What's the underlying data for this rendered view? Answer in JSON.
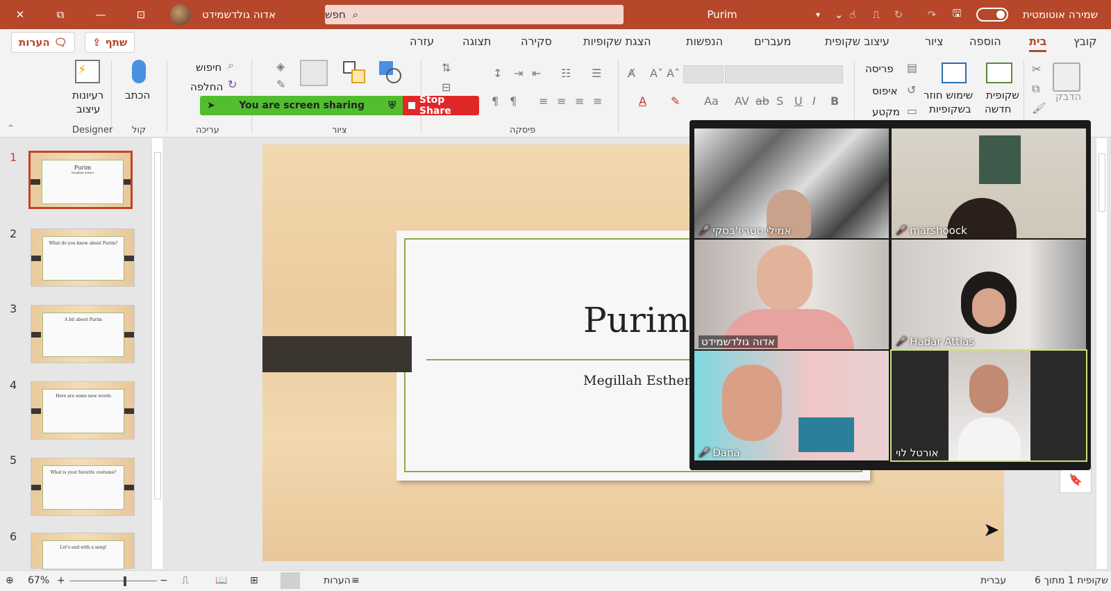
{
  "titlebar": {
    "user_name": "אדוה גולדשמידט",
    "search_placeholder": "חפש",
    "doc_title": "Purim",
    "autosave_label": "שמירה אוטומטית",
    "bg_color": "#b7472a"
  },
  "tabs": [
    "קובץ",
    "בית",
    "הוספה",
    "ציור",
    "עיצוב שקופית",
    "מעברים",
    "הנפשות",
    "הצגת שקופיות",
    "סקירה",
    "תצוגה",
    "עזרה"
  ],
  "active_tab": "בית",
  "comments_btn": "הערות",
  "share_btn": "שתף",
  "ribbon": {
    "clipboard": {
      "paste": "הדבק"
    },
    "slides": {
      "new_slide_1": "שקופית",
      "new_slide_2": "חדשה",
      "reuse_1": "שימוש חוזר",
      "reuse_2": "בשקופיות",
      "layout": "פריסה",
      "reset": "איפוס",
      "section": "מקטע"
    },
    "paragraph_group": "פיסקה",
    "drawing_group": "ציור",
    "shapes": "צורות",
    "arrange": "סדר",
    "quick_styles": "סגנונות",
    "editing": {
      "find": "חיפוש",
      "replace": "החלפה",
      "group": "עריכה"
    },
    "voice": {
      "dictate": "הכתב",
      "group": "קול"
    },
    "designer": {
      "ideas_1": "רעיונות",
      "ideas_2": "עיצוב",
      "group": "Designer"
    }
  },
  "share_bar": {
    "text": "You are screen sharing",
    "stop": "Stop Share"
  },
  "thumbnails": [
    {
      "num": "1",
      "title": "Purim",
      "sub": "Megillah Esther"
    },
    {
      "num": "2",
      "title": "What do you know about Purim?"
    },
    {
      "num": "3",
      "title": "A bit about Purim"
    },
    {
      "num": "4",
      "title": "Here are some new words"
    },
    {
      "num": "5",
      "title": "What is your favorite costume?"
    },
    {
      "num": "6",
      "title": "Let's end with a song!"
    }
  ],
  "slide": {
    "title": "Purim",
    "subtitle": "Megillah Esther"
  },
  "participants": [
    {
      "name": "אמילי סטריז'בסקי",
      "muted": true
    },
    {
      "name": "marshoock",
      "muted": true
    },
    {
      "name": "אדוה גולדשמידט",
      "muted": false
    },
    {
      "name": "Hadar Attias",
      "muted": true
    },
    {
      "name": "Dana",
      "muted": true
    },
    {
      "name": "אורטל לוי",
      "muted": false
    }
  ],
  "status": {
    "slide_info": "שקופית 1 מתוך 6",
    "language": "עברית",
    "notes": "הערות",
    "zoom": "67%"
  }
}
